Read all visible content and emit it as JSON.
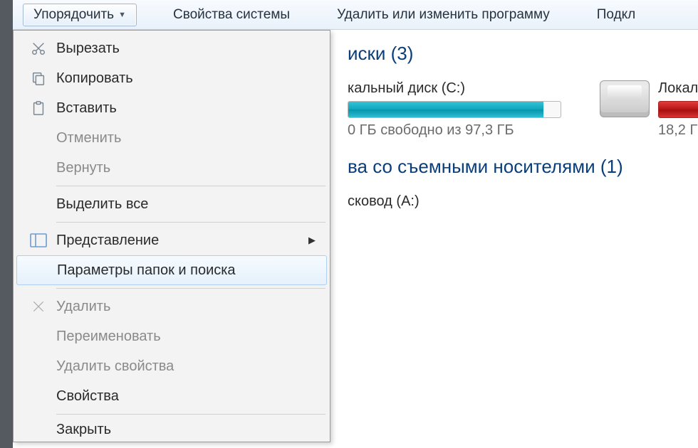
{
  "toolbar": {
    "organize": "Упорядочить",
    "system_props": "Свойства системы",
    "uninstall": "Удалить или изменить программу",
    "connect": "Подкл"
  },
  "menu": {
    "cut": "Вырезать",
    "copy": "Копировать",
    "paste": "Вставить",
    "undo": "Отменить",
    "redo": "Вернуть",
    "select_all": "Выделить все",
    "view": "Представление",
    "folder_options": "Параметры папок и поиска",
    "delete": "Удалить",
    "rename": "Переименовать",
    "remove_properties": "Удалить свойства",
    "properties": "Свойства",
    "close": "Закрыть"
  },
  "content": {
    "section_drives": "иски (3)",
    "driveC": {
      "name": "кальный диск (C:)",
      "free": "0 ГБ свободно из 97,3 ГБ"
    },
    "driveD": {
      "name": "Локал",
      "free": "18,2 Г"
    },
    "section_removable": "ва со съемными носителями (1)",
    "floppy": "сковод (A:)"
  }
}
